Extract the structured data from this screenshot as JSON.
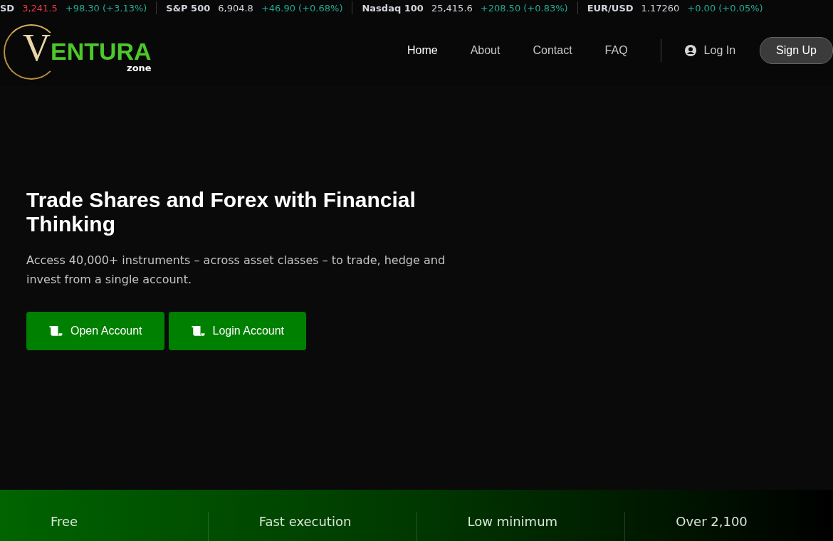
{
  "ticker": [
    {
      "symbol": "SD",
      "price": "3,241.5",
      "change": "+98.30 (+3.13%)",
      "color": "#f23645"
    },
    {
      "symbol": "S&P 500",
      "price": "6,904.8",
      "change": "+46.90 (+0.68%)",
      "color": "#d1d4dc"
    },
    {
      "symbol": "Nasdaq 100",
      "price": "25,415.6",
      "change": "+208.50 (+0.83%)",
      "color": "#d1d4dc"
    },
    {
      "symbol": "EUR/USD",
      "price": "1.17260",
      "change": "+0.00 (+0.05%)",
      "color": "#d1d4dc"
    }
  ],
  "logo": {
    "initial": "V",
    "name": "ENTURA",
    "tagline": "zone"
  },
  "nav": [
    {
      "label": "Home",
      "selected": true
    },
    {
      "label": "About",
      "selected": false
    },
    {
      "label": "Contact",
      "selected": false
    },
    {
      "label": "FAQ",
      "selected": false
    }
  ],
  "login": "Log In",
  "signup": "Sign Up",
  "hero": {
    "title": "Trade Shares and Forex with Financial Thinking",
    "text": "Access 40,000+ instruments – across asset classes – to trade, hedge and invest from a single account.",
    "buttons": [
      "Open Account",
      "Login Account"
    ]
  },
  "features": [
    "Free",
    "Fast execution",
    "Low minimum",
    "Over 2,100"
  ]
}
